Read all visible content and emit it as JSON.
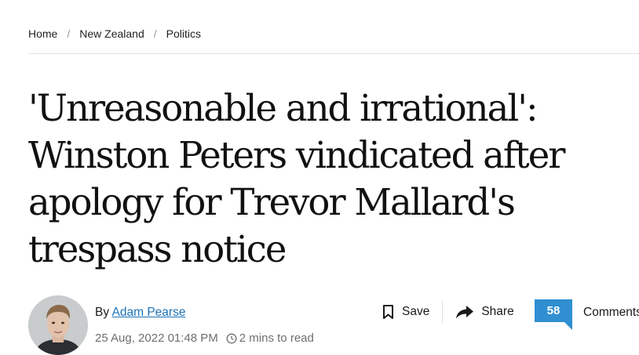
{
  "breadcrumb": {
    "items": [
      "Home",
      "New Zealand",
      "Politics"
    ],
    "separator": "/"
  },
  "headline": "'Unreasonable and irrational': Winston Peters vindicated after apology for Trevor Mallard's trespass notice",
  "byline": {
    "prefix": "By",
    "author": "Adam Pearse"
  },
  "meta": {
    "date": "25 Aug, 2022 01:48 PM",
    "read_time": "2 mins to read"
  },
  "actions": {
    "save": "Save",
    "share": "Share",
    "comment_count": "58",
    "comments": "Comments"
  },
  "colors": {
    "link": "#1c73b7",
    "badge": "#2f8fd1"
  },
  "icons": {
    "save": "bookmark-icon",
    "share": "share-arrow-icon",
    "clock": "clock-icon"
  }
}
